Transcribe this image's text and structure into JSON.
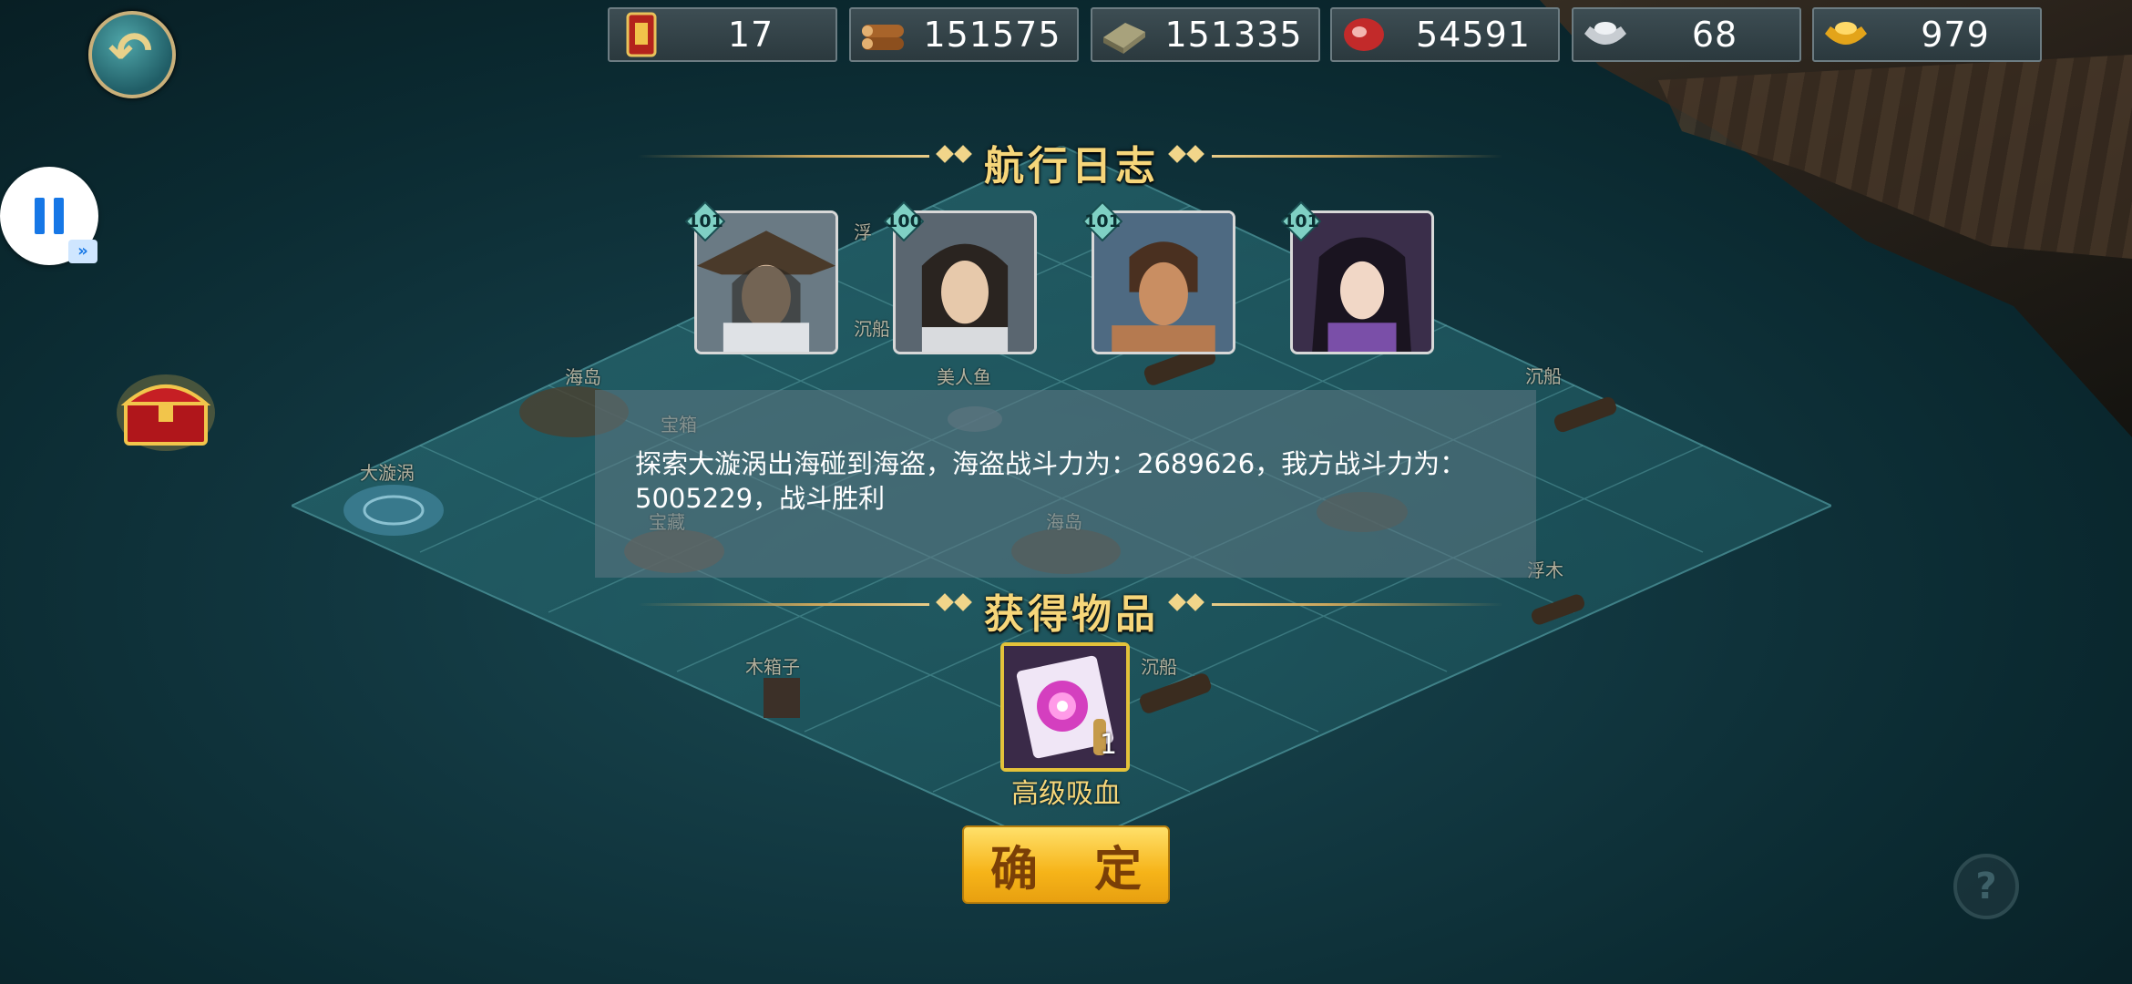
{
  "resources": [
    {
      "icon": "scroll-medal-icon",
      "value": "17"
    },
    {
      "icon": "wood-logs-icon",
      "value": "151575"
    },
    {
      "icon": "stone-slab-icon",
      "value": "151335"
    },
    {
      "icon": "meat-icon",
      "value": "54591"
    },
    {
      "icon": "silver-ingot-icon",
      "value": "68"
    },
    {
      "icon": "gold-ingot-icon",
      "value": "979"
    }
  ],
  "log": {
    "title": "航行日志",
    "heroes": [
      {
        "level": "101"
      },
      {
        "level": "100"
      },
      {
        "level": "101"
      },
      {
        "level": "101"
      }
    ],
    "message": "探索大漩涡出海碰到海盗，海盗战斗力为：2689626，我方战斗力为：5005229，战斗胜利"
  },
  "rewards": {
    "title": "获得物品",
    "item": {
      "name": "高级吸血",
      "count": "1",
      "icon": "purple-scroll-icon"
    }
  },
  "map_labels": [
    "浮",
    "沉船",
    "海岛",
    "美人鱼",
    "宝箱",
    "大漩涡",
    "宝藏",
    "海岛",
    "沉船",
    "浮木",
    "木箱子",
    "沉船"
  ],
  "confirm_label": "确 定",
  "help_label": "?",
  "colors": {
    "accent_gold": "#f6d67a",
    "button_yellow": "#f6b419",
    "panel": "#5e7884"
  }
}
